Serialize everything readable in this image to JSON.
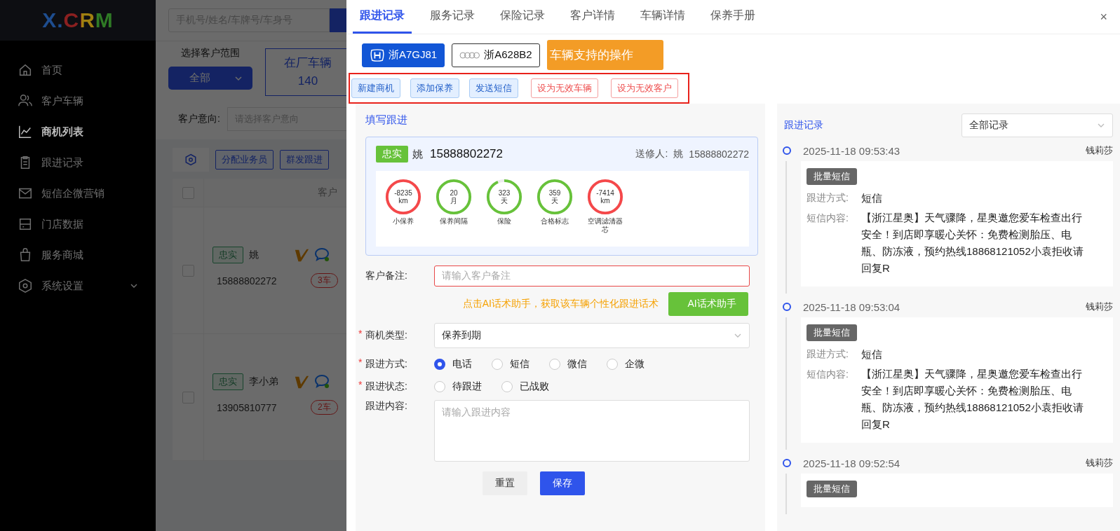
{
  "app": {
    "logo": "X.CRM",
    "sidebar": {
      "items": [
        {
          "label": "首页",
          "selected": false
        },
        {
          "label": "客户车辆",
          "selected": false
        },
        {
          "label": "商机列表",
          "selected": true
        },
        {
          "label": "跟进记录",
          "selected": false
        },
        {
          "label": "短信企微营销",
          "selected": false
        },
        {
          "label": "门店数据",
          "selected": false
        },
        {
          "label": "服务商城",
          "selected": false
        },
        {
          "label": "系统设置",
          "selected": false,
          "expanded": false
        }
      ]
    },
    "search": {
      "placeholder": "手机号/姓名/车牌号/车身号"
    },
    "scope": {
      "label": "选择客户范围",
      "value": "全部"
    },
    "stat": {
      "label": "在厂车辆",
      "value": "140"
    },
    "intent": {
      "label": "客户意向:",
      "placeholder": "请选择客户意向"
    },
    "toolbar": [
      "分配业务员",
      "群发跟进"
    ],
    "table": {
      "columns": [
        "客户"
      ],
      "header_checked": false,
      "rows": [
        {
          "checked": false,
          "tag": "忠实",
          "name": "姚",
          "phone": "15888802272",
          "cars": "3车"
        },
        {
          "checked": false,
          "tag": "忠实",
          "name": "李小弟",
          "phone": "13905810777",
          "cars": "2车"
        }
      ]
    }
  },
  "drawer": {
    "tabs": [
      {
        "label": "跟进记录",
        "selected": true
      },
      {
        "label": "服务记录",
        "selected": false
      },
      {
        "label": "保险记录",
        "selected": false
      },
      {
        "label": "客户详情",
        "selected": false
      },
      {
        "label": "车辆详情",
        "selected": false
      },
      {
        "label": "保养手册",
        "selected": false
      }
    ],
    "close": "×",
    "vehicles": [
      {
        "plate": "浙A7GJ81",
        "selected": true
      },
      {
        "plate": "浙A628B2",
        "selected": false
      }
    ],
    "annotation": "车辆支持的操作",
    "actions": [
      {
        "label": "新建商机",
        "kind": "primary"
      },
      {
        "label": "添加保养",
        "kind": "primary"
      },
      {
        "label": "发送短信",
        "kind": "primary"
      },
      {
        "label": "设为无效车辆",
        "kind": "danger"
      },
      {
        "label": "设为无效客户",
        "kind": "danger"
      }
    ],
    "form": {
      "title": "填写跟进",
      "customer": {
        "tag": "忠实",
        "name": "姚",
        "phone": "15888802272",
        "sender_label": "送修人:",
        "sender_name": "姚",
        "sender_phone": "15888802272"
      },
      "gauges": [
        {
          "value": "-8235",
          "unit": "km",
          "label": "小保养",
          "color": "#f5484a",
          "level": 1
        },
        {
          "value": "20",
          "unit": "月",
          "label": "保养间隔",
          "color": "#67c23a",
          "level": 1
        },
        {
          "value": "323",
          "unit": "天",
          "label": "保险",
          "color": "#67c23a",
          "level": 0.93
        },
        {
          "value": "359",
          "unit": "天",
          "label": "合格标志",
          "color": "#67c23a",
          "level": 1
        },
        {
          "value": "-7414",
          "unit": "km",
          "label": "空调滤清器芯",
          "color": "#f5484a",
          "level": 1
        }
      ],
      "remark": {
        "label": "客户备注:",
        "placeholder": "请输入客户备注",
        "error": true
      },
      "ai": {
        "hint": "点击AI话术助手，获取该车辆个性化跟进话术",
        "button": "AI话术助手"
      },
      "type": {
        "label": "商机类型:",
        "required_mark": "*",
        "value": "保养到期"
      },
      "method": {
        "label": "跟进方式:",
        "required_mark": "*",
        "options": [
          {
            "label": "电话",
            "selected": true
          },
          {
            "label": "短信",
            "selected": false
          },
          {
            "label": "微信",
            "selected": false
          },
          {
            "label": "企微",
            "selected": false
          }
        ]
      },
      "status": {
        "label": "跟进状态:",
        "required_mark": "*",
        "options": [
          {
            "label": "待跟进",
            "selected": false
          },
          {
            "label": "已战败",
            "selected": false
          }
        ]
      },
      "content": {
        "label": "跟进内容:",
        "placeholder": "请输入跟进内容"
      },
      "buttons": {
        "reset": "重置",
        "save": "保存"
      }
    },
    "records": {
      "title": "跟进记录",
      "filter": "全部记录",
      "entries": [
        {
          "time": "2025-11-18 09:53:43",
          "person": "钱莉莎",
          "tag": "批量短信",
          "method_label": "跟进方式:",
          "method": "短信",
          "content_label": "短信内容:",
          "content": "【浙江星奥】天气骤降，星奥邀您爱车检查出行安全！到店即享暖心关怀：免费检测胎压、电瓶、防冻液，预约热线18868121052小袁拒收请回复R"
        },
        {
          "time": "2025-11-18 09:53:04",
          "person": "钱莉莎",
          "tag": "批量短信",
          "method_label": "跟进方式:",
          "method": "短信",
          "content_label": "短信内容:",
          "content": "【浙江星奥】天气骤降，星奥邀您爱车检查出行安全！到店即享暖心关怀：免费检测胎压、电瓶、防冻液，预约热线18868121052小袁拒收请回复R"
        },
        {
          "time": "2025-11-18 09:52:54",
          "person": "钱莉莎",
          "tag": "批量短信"
        }
      ]
    }
  }
}
